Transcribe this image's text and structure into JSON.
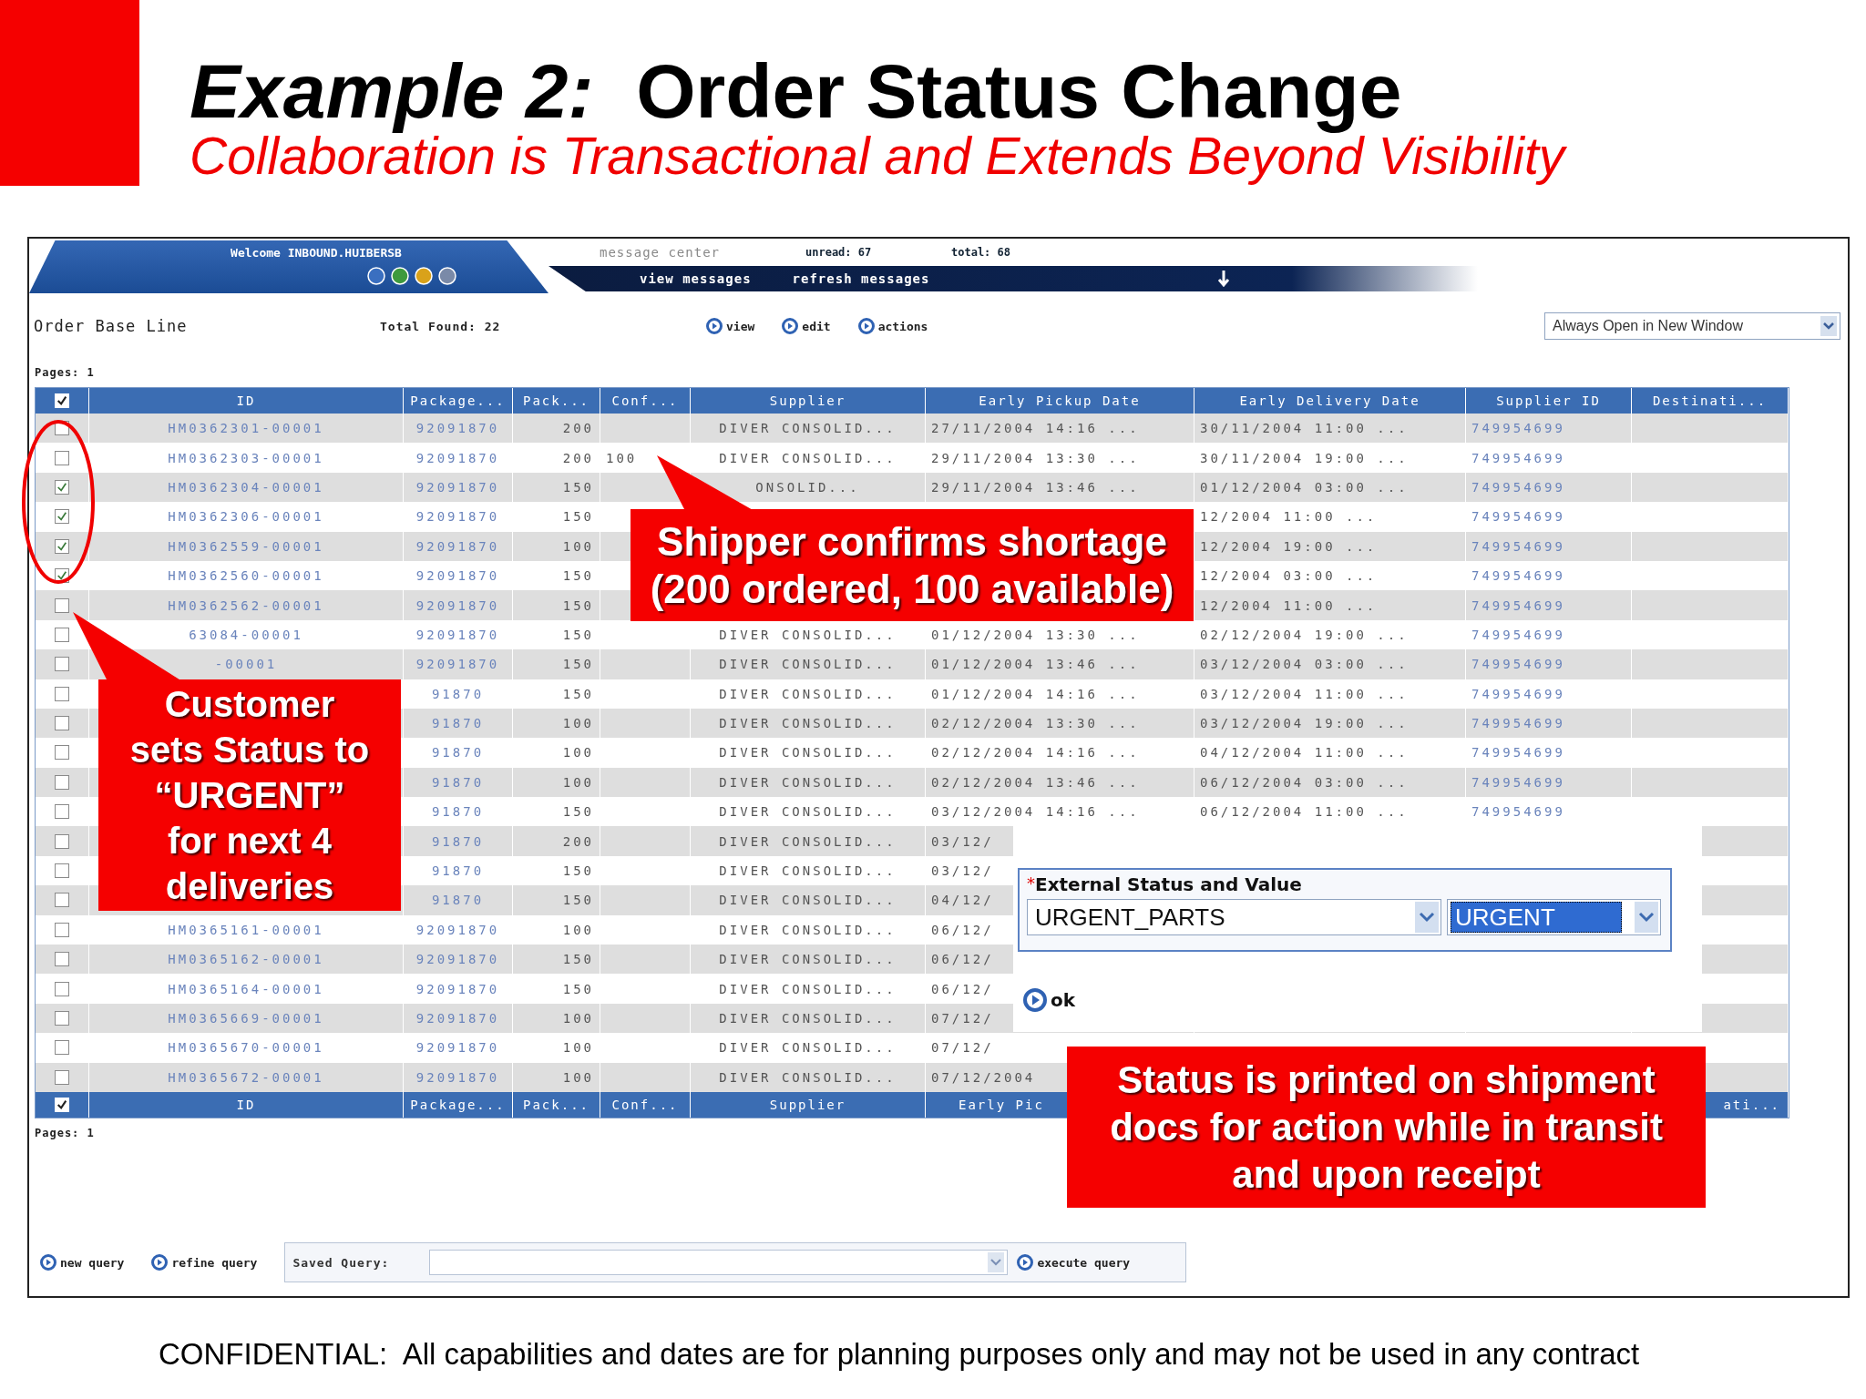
{
  "slide": {
    "title": "*Example 2:*  Order Status Change",
    "subtitle": "Collaboration is Transactional and Extends Beyond Visibility",
    "footer": "CONFIDENTIAL:  All capabilities and dates are for planning purposes only and may not be used in any contract"
  },
  "app": {
    "welcome": "Welcome INBOUND.HUIBERSB",
    "message_center": "message center",
    "unread": "unread: 67",
    "total": "total: 68",
    "message_links": [
      "view messages",
      "refresh messages"
    ]
  },
  "toolbar": {
    "title": "Order Base Line",
    "total_found": "Total Found: 22",
    "actions": [
      "view",
      "edit",
      "actions"
    ],
    "window_mode": "Always Open in New Window"
  },
  "pages_top": "Pages: 1",
  "table": {
    "header_checked": true,
    "footer_checked": true,
    "columns": [
      "ID",
      "Package...",
      "Pack...",
      "Conf...",
      "Supplier",
      "Early Pickup Date",
      "Early Delivery Date",
      "Supplier ID",
      "Destinati..."
    ],
    "footer_columns": [
      "ID",
      "Package...",
      "Pack...",
      "Conf...",
      "Supplier",
      "Early Pic",
      null,
      null,
      "ati..."
    ],
    "rows": [
      {
        "checked": false,
        "cells": [
          "HM0362301-00001",
          "92091870",
          "200",
          null,
          "DIVER CONSOLID...",
          "27/11/2004 14:16 ...",
          "30/11/2004 11:00 ...",
          "749954699",
          null
        ]
      },
      {
        "checked": false,
        "cells": [
          "HM0362303-00001",
          "92091870",
          "200",
          "100",
          "DIVER CONSOLID...",
          "29/11/2004 13:30 ...",
          "30/11/2004 19:00 ...",
          "749954699",
          null
        ]
      },
      {
        "checked": true,
        "cells": [
          "HM0362304-00001",
          "92091870",
          "150",
          null,
          "ONSOLID...",
          "29/11/2004 13:46 ...",
          "01/12/2004 03:00 ...",
          "749954699",
          null
        ]
      },
      {
        "checked": true,
        "cells": [
          "HM0362306-00001",
          "92091870",
          "150",
          null,
          null,
          null,
          "12/2004 11:00 ...",
          "749954699",
          null
        ]
      },
      {
        "checked": true,
        "cells": [
          "HM0362559-00001",
          "92091870",
          "100",
          null,
          null,
          null,
          "12/2004 19:00 ...",
          "749954699",
          null
        ]
      },
      {
        "checked": true,
        "cells": [
          "HM0362560-00001",
          "92091870",
          "150",
          null,
          null,
          null,
          "12/2004 03:00 ...",
          "749954699",
          null
        ]
      },
      {
        "checked": false,
        "cells": [
          "HM0362562-00001",
          "92091870",
          "150",
          null,
          null,
          null,
          "12/2004 11:00 ...",
          "749954699",
          null
        ]
      },
      {
        "checked": false,
        "cells": [
          "63084-00001",
          "92091870",
          "150",
          null,
          "DIVER CONSOLID...",
          "01/12/2004 13:30 ...",
          "02/12/2004 19:00 ...",
          "749954699",
          null
        ]
      },
      {
        "checked": false,
        "cells": [
          "-00001",
          "92091870",
          "150",
          null,
          "DIVER CONSOLID...",
          "01/12/2004 13:46 ...",
          "03/12/2004 03:00 ...",
          "749954699",
          null
        ]
      },
      {
        "checked": false,
        "cells": [
          null,
          "91870",
          "150",
          null,
          "DIVER CONSOLID...",
          "01/12/2004 14:16 ...",
          "03/12/2004 11:00 ...",
          "749954699",
          null
        ]
      },
      {
        "checked": false,
        "cells": [
          null,
          "91870",
          "100",
          null,
          "DIVER CONSOLID...",
          "02/12/2004 13:30 ...",
          "03/12/2004 19:00 ...",
          "749954699",
          null
        ]
      },
      {
        "checked": false,
        "cells": [
          null,
          "91870",
          "100",
          null,
          "DIVER CONSOLID...",
          "02/12/2004 14:16 ...",
          "04/12/2004 11:00 ...",
          "749954699",
          null
        ]
      },
      {
        "checked": false,
        "cells": [
          null,
          "91870",
          "100",
          null,
          "DIVER CONSOLID...",
          "02/12/2004 13:46 ...",
          "06/12/2004 03:00 ...",
          "749954699",
          null
        ]
      },
      {
        "checked": false,
        "cells": [
          null,
          "91870",
          "150",
          null,
          "DIVER CONSOLID...",
          "03/12/2004 14:16 ...",
          "06/12/2004 11:00 ...",
          "749954699",
          null
        ]
      },
      {
        "checked": false,
        "cells": [
          null,
          "91870",
          "200",
          null,
          "DIVER CONSOLID...",
          "03/12/",
          null,
          null,
          null
        ]
      },
      {
        "checked": false,
        "cells": [
          null,
          "91870",
          "150",
          null,
          "DIVER CONSOLID...",
          "03/12/",
          null,
          null,
          null
        ]
      },
      {
        "checked": false,
        "cells": [
          null,
          "91870",
          "150",
          null,
          "DIVER CONSOLID...",
          "04/12/",
          null,
          null,
          null
        ]
      },
      {
        "checked": false,
        "cells": [
          "HM0365161-00001",
          "92091870",
          "100",
          null,
          "DIVER CONSOLID...",
          "06/12/",
          null,
          null,
          null
        ]
      },
      {
        "checked": false,
        "cells": [
          "HM0365162-00001",
          "92091870",
          "150",
          null,
          "DIVER CONSOLID...",
          "06/12/",
          null,
          null,
          null
        ]
      },
      {
        "checked": false,
        "cells": [
          "HM0365164-00001",
          "92091870",
          "150",
          null,
          "DIVER CONSOLID...",
          "06/12/",
          null,
          null,
          null
        ]
      },
      {
        "checked": false,
        "cells": [
          "HM0365669-00001",
          "92091870",
          "100",
          null,
          "DIVER CONSOLID...",
          "07/12/",
          null,
          null,
          null
        ]
      },
      {
        "checked": false,
        "cells": [
          "HM0365670-00001",
          "92091870",
          "100",
          null,
          "DIVER CONSOLID...",
          "07/12/",
          null,
          null,
          null
        ]
      },
      {
        "checked": false,
        "cells": [
          "HM0365672-00001",
          "92091870",
          "100",
          null,
          "DIVER CONSOLID...",
          "07/12/2004",
          null,
          null,
          null
        ]
      }
    ]
  },
  "pages_bottom": "Pages: 1",
  "status_dialog": {
    "required_mark": "*",
    "label": "External Status and Value",
    "status": "URGENT_PARTS",
    "value": "URGENT",
    "ok": "ok"
  },
  "bottom": {
    "links": [
      "new query",
      "refine query"
    ],
    "saved_query_label": "Saved Query:",
    "execute": "execute query"
  },
  "callouts": [
    {
      "kind": "shipper",
      "lines": [
        "Shipper confirms shortage",
        "(200 ordered, 100 available)"
      ]
    },
    {
      "kind": "customer",
      "lines": [
        "Customer",
        "sets Status to",
        "“URGENT”",
        "for next 4",
        "deliveries"
      ]
    },
    {
      "kind": "status",
      "lines": [
        "Status is printed on shipment",
        "docs for action while in transit",
        "and upon receipt"
      ]
    }
  ]
}
